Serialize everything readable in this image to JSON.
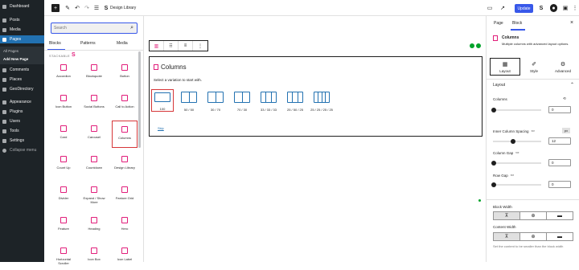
{
  "wp_menu": {
    "items": [
      {
        "label": "Dashboard",
        "icon": "dashboard-icon"
      },
      {
        "label": "Posts",
        "icon": "pin-icon"
      },
      {
        "label": "Media",
        "icon": "media-icon"
      },
      {
        "label": "Pages",
        "icon": "pages-icon"
      },
      {
        "label": "Comments",
        "icon": "comment-icon"
      },
      {
        "label": "Places",
        "icon": "places-icon"
      },
      {
        "label": "GeoDirectory",
        "icon": "geodirectory-icon"
      },
      {
        "label": "Appearance",
        "icon": "appearance-icon"
      },
      {
        "label": "Plugins",
        "icon": "plugins-icon"
      },
      {
        "label": "Users",
        "icon": "users-icon"
      },
      {
        "label": "Tools",
        "icon": "tools-icon"
      },
      {
        "label": "Settings",
        "icon": "settings-icon"
      },
      {
        "label": "Collapse menu",
        "icon": "collapse-icon"
      }
    ],
    "submenu": [
      "All Pages",
      "Add New Page"
    ]
  },
  "toolbar": {
    "add_label": "+",
    "page_title": "Design Library",
    "update_label": "Update"
  },
  "inserter": {
    "search_placeholder": "Search",
    "tabs": [
      "Blocks",
      "Patterns",
      "Media"
    ],
    "category": "STACKABLE",
    "blocks": [
      "Accordion",
      "Blockquote",
      "Button",
      "Icon Button",
      "Social Buttons",
      "Call to Action",
      "Card",
      "Carousel",
      "Columns",
      "Count Up",
      "Countdown",
      "Design Library",
      "Divider",
      "Expand / Show More",
      "Feature Grid",
      "Feature",
      "Heading",
      "Hero",
      "Horizontal Scroller",
      "Icon Box",
      "Icon Label"
    ]
  },
  "canvas": {
    "placeholder_title": "Columns",
    "placeholder_help": "Select a variation to start with.",
    "variations": [
      "100",
      "50 / 50",
      "30 / 70",
      "70 / 30",
      "33 / 33 / 33",
      "25 / 50 / 25",
      "25 / 25 / 25 / 25"
    ],
    "skip_label": "Skip"
  },
  "settings": {
    "tabs": [
      "Page",
      "Block"
    ],
    "block_title": "Columns",
    "block_desc": "Multiple columns with advanced layout options.",
    "subtabs": [
      "Layout",
      "Style",
      "Advanced"
    ],
    "section_title": "Layout",
    "columns_label": "Columns",
    "columns_value": "0",
    "inner_spacing_label": "Inner Column Spacing",
    "inner_spacing_value": "12",
    "inner_spacing_unit": "px",
    "column_gap_label": "Column Gap",
    "column_gap_value": "0",
    "row_gap_label": "Row Gap",
    "row_gap_value": "0",
    "block_width_label": "Block Width",
    "content_width_label": "Content Width",
    "content_width_note": "Set the content to be smaller than the block width"
  },
  "colors": {
    "accent": "#3858e9",
    "stackable": "#e11d7a",
    "admin_bar": "#1d2327",
    "admin_active": "#2271b1",
    "highlight": "#d63638"
  }
}
